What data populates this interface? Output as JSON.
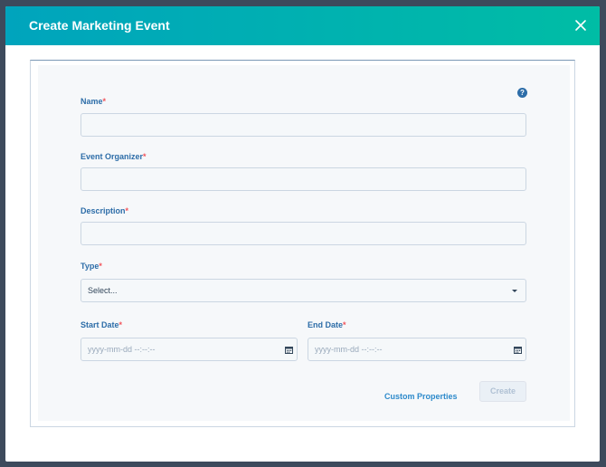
{
  "modal": {
    "title": "Create Marketing Event"
  },
  "form": {
    "name": {
      "label": "Name",
      "required_mark": "*",
      "value": "",
      "placeholder": ""
    },
    "organizer": {
      "label": "Event Organizer",
      "required_mark": "*",
      "value": "",
      "placeholder": ""
    },
    "description": {
      "label": "Description",
      "required_mark": "*",
      "value": "",
      "placeholder": ""
    },
    "type": {
      "label": "Type",
      "required_mark": "*",
      "selected": "Select..."
    },
    "start_date": {
      "label": "Start Date",
      "required_mark": "*",
      "placeholder": "yyyy-mm-dd --:--:--"
    },
    "end_date": {
      "label": "End Date",
      "required_mark": "*",
      "placeholder": "yyyy-mm-dd --:--:--"
    },
    "help_glyph": "?"
  },
  "footer": {
    "custom_properties_label": "Custom Properties",
    "create_label": "Create"
  },
  "colors": {
    "header_gradient_start": "#00a4bd",
    "header_gradient_end": "#00bda5",
    "label": "#2d6da8",
    "required": "#f2545b",
    "link": "#2d8acb",
    "disabled_button_bg": "#eaf0f6",
    "disabled_button_text": "#b0c1d4"
  },
  "icons": {
    "close": "close-icon",
    "help": "help-icon",
    "calendar": "calendar-icon",
    "caret": "caret-down-icon"
  }
}
